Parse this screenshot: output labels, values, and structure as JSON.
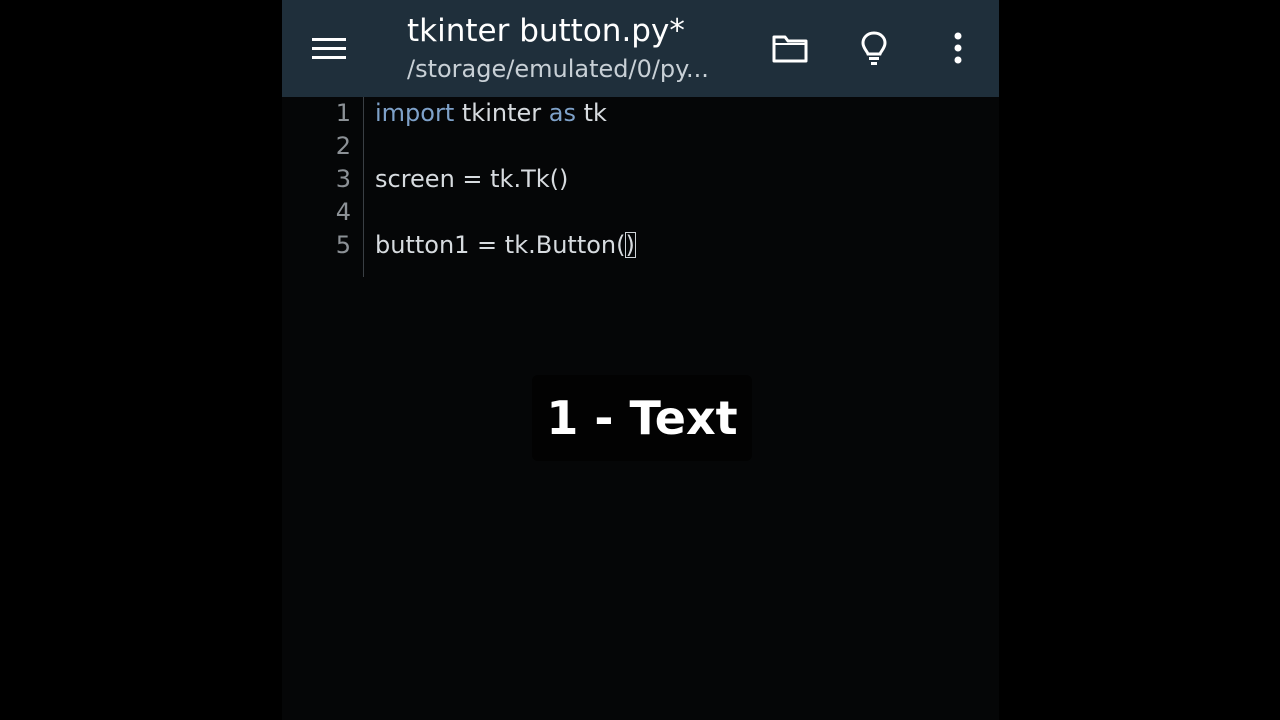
{
  "appbar": {
    "title": "tkinter button.py*",
    "subtitle": "/storage/emulated/0/py...",
    "menu_icon": "menu-icon",
    "folder_icon": "folder-icon",
    "bulb_icon": "lightbulb-icon",
    "more_icon": "more-vert-icon"
  },
  "editor": {
    "line_numbers": [
      "1",
      "2",
      "3",
      "4",
      "5"
    ],
    "lines": {
      "l1_kw1": "import",
      "l1_text1": " tkinter ",
      "l1_kw2": "as",
      "l1_text2": " tk",
      "l3": "screen = tk.Tk()",
      "l5_text": "button1 = tk.Button(",
      "l5_cursor": ")"
    }
  },
  "overlay": {
    "caption": "1 - Text"
  },
  "colors": {
    "appbar": "#1f2f3b",
    "editor_bg": "#050607",
    "keyword": "#7ea1c9",
    "code_text": "#d7dbdf",
    "line_number": "#8c9196"
  }
}
